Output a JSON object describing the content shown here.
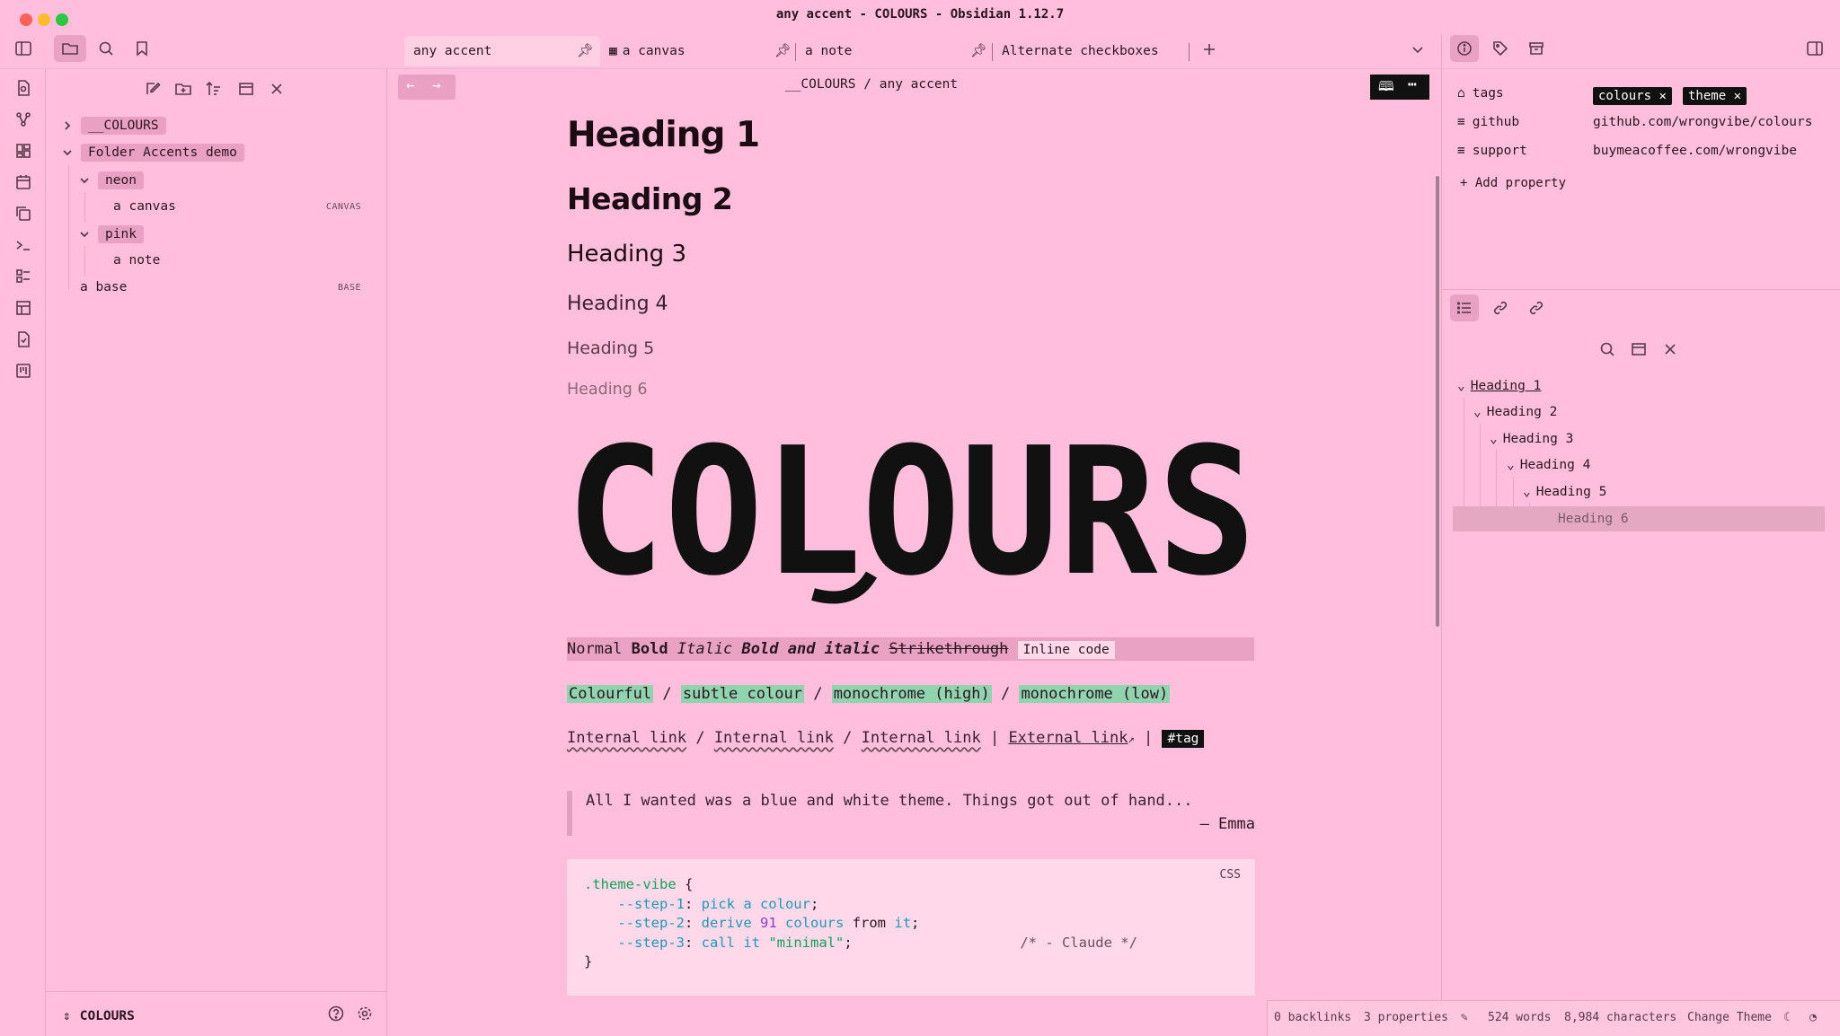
{
  "window": {
    "title": "any accent - COLOURS - Obsidian 1.12.7"
  },
  "tabs": [
    {
      "label": "any accent"
    },
    {
      "label": "a canvas"
    },
    {
      "label": "a note"
    },
    {
      "label": "Alternate checkboxes"
    }
  ],
  "breadcrumb": {
    "folder": "__COLOURS",
    "sep": "/",
    "file": "any accent"
  },
  "file_tree": {
    "root_folder": "__COLOURS",
    "folder_demo": "Folder Accents demo",
    "neon": "neon",
    "canvas": "a canvas",
    "canvas_badge": "CANVAS",
    "pink": "pink",
    "note": "a note",
    "base": "a base",
    "base_badge": "BASE"
  },
  "vault": {
    "name": "COLOURS"
  },
  "editor": {
    "h1": "Heading 1",
    "h2": "Heading 2",
    "h3": "Heading 3",
    "h4": "Heading 4",
    "h5": "Heading 5",
    "h6": "Heading 6",
    "logo_text": "COLOURS",
    "fmt": {
      "normal": "Normal",
      "bold": "Bold",
      "italic": "Italic",
      "bold_italic": "Bold and italic",
      "strike": "Strikethrough",
      "code": "Inline code"
    },
    "hl": {
      "colourful": "Colourful",
      "subtle": "subtle colour",
      "mono_high": "monochrome (high)",
      "mono_low": "monochrome (low)",
      "sep": "/"
    },
    "links": {
      "internal": "Internal link",
      "sep": "/",
      "bar": "|",
      "external": "External link",
      "tag": "#tag"
    },
    "quote": {
      "text": "All I wanted was a blue and white theme. Things got out of hand...",
      "author": "— Emma"
    },
    "code": {
      "lang": "CSS",
      "selector": ".theme-vibe",
      "open": "{",
      "close": "}",
      "p1": "--step-1",
      "v1": "pick a colour",
      "p2": "--step-2",
      "v2a": "derive",
      "v2n": "91",
      "v2b": "colours",
      "v2c": "from",
      "v2d": "it",
      "p3": "--step-3",
      "v3a": "call it",
      "v3s": "\"minimal\"",
      "comment": "/* - Claude */"
    }
  },
  "properties": {
    "tags_label": "tags",
    "tag1": "colours",
    "tag2": "theme",
    "github_label": "github",
    "github_value": "github.com/wrongvibe/colours",
    "support_label": "support",
    "support_value": "buymeacoffee.com/wrongvibe",
    "add": "Add property"
  },
  "outline": [
    "Heading 1",
    "Heading 2",
    "Heading 3",
    "Heading 4",
    "Heading 5",
    "Heading 6"
  ],
  "status": {
    "backlinks": "0 backlinks",
    "properties": "3 properties",
    "words": "524 words",
    "chars": "8,984 characters",
    "theme": "Change Theme"
  }
}
